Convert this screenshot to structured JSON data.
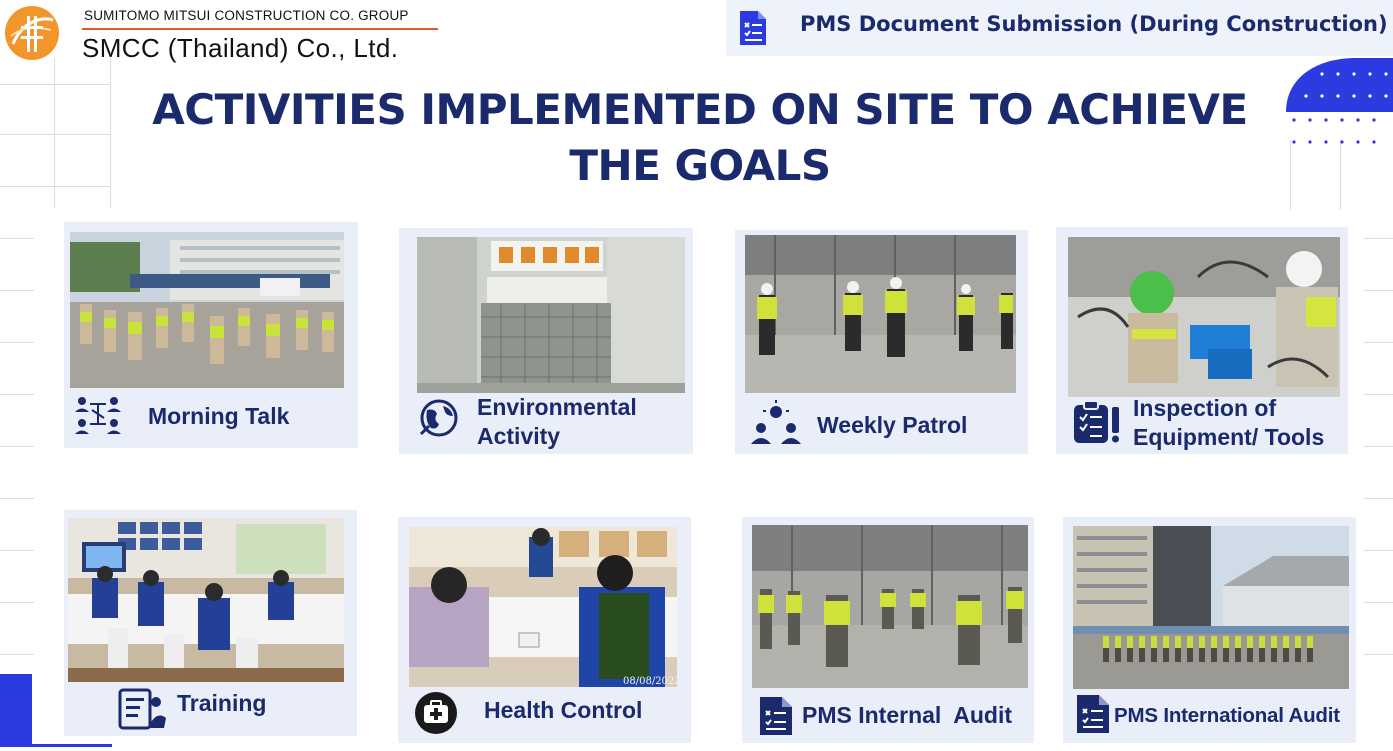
{
  "header": {
    "company_group": "SUMITOMO MITSUI CONSTRUCTION CO. GROUP",
    "company_name": "SMCC (Thailand) Co., Ltd.",
    "document_title": "PMS Document Submission (During Construction)"
  },
  "page": {
    "title": "ACTIVITIES IMPLEMENTED ON SITE TO ACHIEVE THE GOALS"
  },
  "activities": [
    {
      "label": "Morning Talk",
      "icon": "team-meeting-icon"
    },
    {
      "label": "Environmental Activity",
      "icon": "globe-icon"
    },
    {
      "label": "Weekly Patrol",
      "icon": "patrol-team-icon"
    },
    {
      "label": "Inspection of Equipment/ Tools",
      "icon": "checklist-clipboard-icon"
    },
    {
      "label": "Training",
      "icon": "training-board-icon"
    },
    {
      "label": "Health Control",
      "icon": "first-aid-kit-icon"
    },
    {
      "label": "PMS Internal  Audit",
      "icon": "audit-document-icon"
    },
    {
      "label": "PMS International Audit",
      "icon": "audit-document-icon"
    }
  ],
  "photo_stamps": {
    "health_control_date": "08/08/2022"
  },
  "colors": {
    "brand_navy": "#1a2a6c",
    "accent_blue": "#2b3be0",
    "card_bg": "#e9eef8",
    "logo_orange": "#f2962c"
  }
}
